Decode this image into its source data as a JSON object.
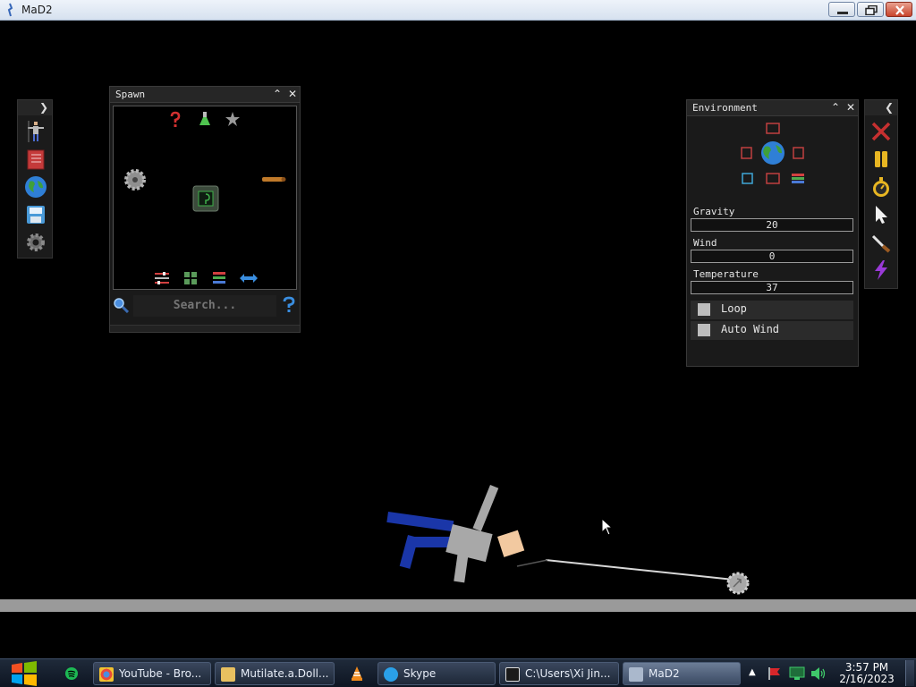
{
  "window": {
    "title": "MaD2"
  },
  "spawn_panel": {
    "title": "Spawn",
    "search_placeholder": "Search..."
  },
  "environment_panel": {
    "title": "Environment",
    "fields": [
      {
        "label": "Gravity",
        "value": "20"
      },
      {
        "label": "Wind",
        "value": "0"
      },
      {
        "label": "Temperature",
        "value": "37"
      }
    ],
    "checkboxes": [
      {
        "label": "Loop",
        "checked": false
      },
      {
        "label": "Auto Wind",
        "checked": false
      }
    ]
  },
  "left_toolbar": {
    "items": [
      "ragdoll-icon",
      "book-icon",
      "globe-icon",
      "save-icon",
      "gear-icon"
    ]
  },
  "right_toolbar": {
    "items": [
      "close-x-icon",
      "pause-icon",
      "stopwatch-icon",
      "cursor-icon",
      "knife-icon",
      "lightning-icon"
    ]
  },
  "taskbar": {
    "tasks": [
      {
        "label": "YouTube - Bro...",
        "icon": "chrome-icon"
      },
      {
        "label": "Mutilate.a.Doll...",
        "icon": "folder-icon"
      },
      {
        "label": "Skype",
        "icon": "skype-icon"
      },
      {
        "label": "C:\\Users\\Xi Jin...",
        "icon": "7zip-icon"
      },
      {
        "label": "MaD2",
        "icon": "mad2-icon"
      }
    ],
    "clock_time": "3:57 PM",
    "clock_date": "2/16/2023"
  },
  "colors": {
    "panel_bg": "#1a1a1a",
    "floor": "#9a9a9a",
    "ragdoll_legs": "#1a36a8",
    "ragdoll_body": "#a8a8a8",
    "ragdoll_head": "#f2c9a0"
  }
}
